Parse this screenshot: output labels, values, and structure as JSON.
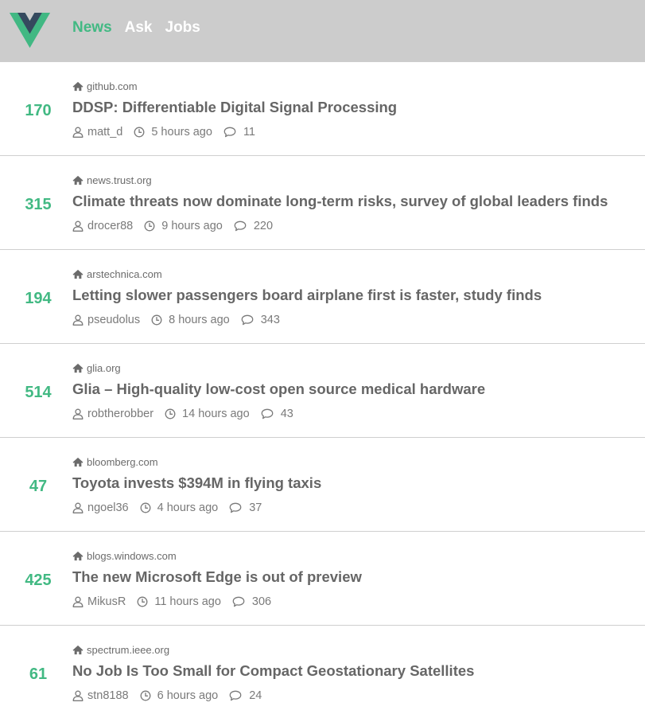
{
  "header": {
    "logo_name": "vue-logo",
    "colors": {
      "bar": "#cccccc",
      "active": "#42b983",
      "inactive": "#ffffff"
    },
    "nav": [
      {
        "label": "News",
        "active": true
      },
      {
        "label": "Ask",
        "active": false
      },
      {
        "label": "Jobs",
        "active": false
      }
    ]
  },
  "stories": [
    {
      "score": "170",
      "domain": "github.com",
      "title": "DDSP: Differentiable Digital Signal Processing",
      "user": "matt_d",
      "time": "5 hours ago",
      "comments": "11"
    },
    {
      "score": "315",
      "domain": "news.trust.org",
      "title": "Climate threats now dominate long-term risks, survey of global leaders finds",
      "user": "drocer88",
      "time": "9 hours ago",
      "comments": "220"
    },
    {
      "score": "194",
      "domain": "arstechnica.com",
      "title": "Letting slower passengers board airplane first is faster, study finds",
      "user": "pseudolus",
      "time": "8 hours ago",
      "comments": "343"
    },
    {
      "score": "514",
      "domain": "glia.org",
      "title": "Glia – High-quality low-cost open source medical hardware",
      "user": "robtherobber",
      "time": "14 hours ago",
      "comments": "43"
    },
    {
      "score": "47",
      "domain": "bloomberg.com",
      "title": "Toyota invests $394M in flying taxis",
      "user": "ngoel36",
      "time": "4 hours ago",
      "comments": "37"
    },
    {
      "score": "425",
      "domain": "blogs.windows.com",
      "title": "The new Microsoft Edge is out of preview",
      "user": "MikusR",
      "time": "11 hours ago",
      "comments": "306"
    },
    {
      "score": "61",
      "domain": "spectrum.ieee.org",
      "title": "No Job Is Too Small for Compact Geostationary Satellites",
      "user": "stn8188",
      "time": "6 hours ago",
      "comments": "24"
    }
  ]
}
